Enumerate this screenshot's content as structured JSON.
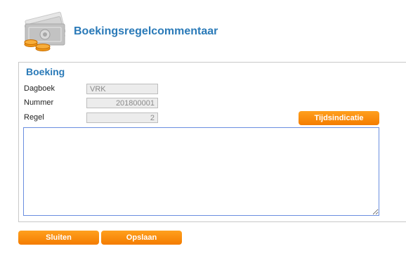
{
  "header": {
    "title": "Boekingsregelcommentaar",
    "icon": "money-icon"
  },
  "panel": {
    "title": "Boeking",
    "fields": {
      "dagboek_label": "Dagboek",
      "dagboek_value": "VRK",
      "nummer_label": "Nummer",
      "nummer_value": "201800001",
      "regel_label": "Regel",
      "regel_value": "2"
    },
    "time_button_label": "Tijdsindicatie",
    "comment_value": ""
  },
  "footer": {
    "close_label": "Sluiten",
    "save_label": "Opslaan"
  },
  "colors": {
    "title": "#2a7ab8",
    "button": "#f7890c",
    "textarea_border": "#6a8ee0"
  }
}
